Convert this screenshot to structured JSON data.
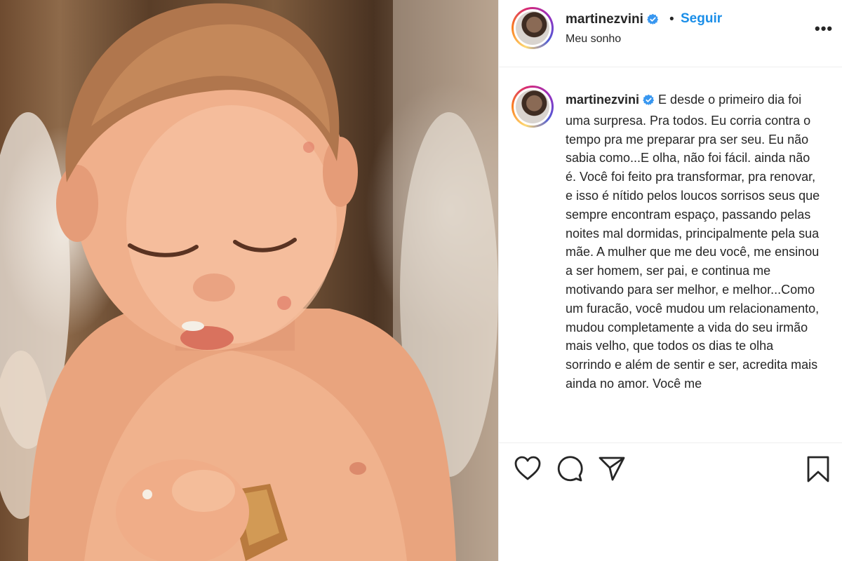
{
  "post": {
    "image_alt": "baby eating a biscuit",
    "author": {
      "username": "martinezvini",
      "verified": true,
      "avatar": "profile-photo"
    },
    "follow_label": "Seguir",
    "separator": "•",
    "location": "Meu sonho",
    "more_icon": "more-options-icon",
    "more_label": "•••",
    "caption": "E desde o primeiro dia foi uma surpresa. Pra todos. Eu corria contra o tempo pra me preparar pra ser seu. Eu não sabia como...E olha, não foi fácil. ainda não é. Você foi feito pra transformar, pra renovar, e isso é nítido pelos loucos sorrisos seus que sempre encontram espaço, passando pelas noites mal dormidas, principalmente pela sua mãe. A mulher que me deu você, me ensinou a ser homem, ser pai, e continua me motivando para ser melhor, e melhor...Como um furacão, você mudou um relacionamento, mudou completamente a vida do seu irmão mais velho, que todos os dias te olha sorrindo e além de sentir e ser, acredita mais ainda no amor. Você me"
  },
  "actions": {
    "like": "heart-icon",
    "comment": "comment-icon",
    "share": "paper-plane-icon",
    "save": "bookmark-icon"
  },
  "colors": {
    "link": "#1a8ee8",
    "verified": "#3897f0",
    "text": "#262626",
    "divider": "#efefef"
  }
}
